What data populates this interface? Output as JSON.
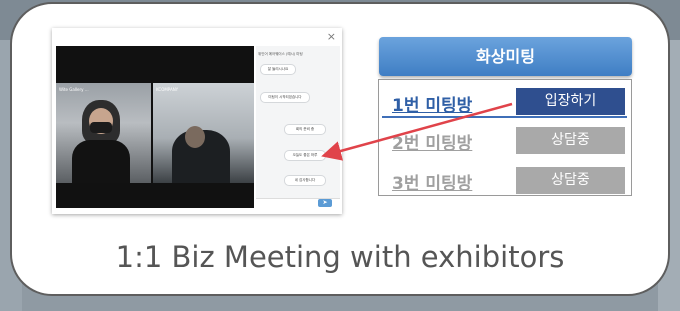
{
  "meeting_panel": {
    "title": "화상미팅",
    "rooms": [
      {
        "name": "1번 미팅방",
        "status": "입장하기"
      },
      {
        "name": "2번 미팅방",
        "status": "상담중"
      },
      {
        "name": "3번 미팅방",
        "status": "상담중"
      }
    ]
  },
  "screenshot": {
    "close": "×",
    "feed_labels": [
      "Wite Gallery ...",
      "KCOMPANY"
    ],
    "chat_title": "위인어 에어웨이스 (예시) 미팅",
    "bubbles": [
      "잘 들리시나요",
      "미팅이 시작되었습니다",
      "회의 준비 중",
      "오늘도 좋은 하루",
      "네 감사합니다"
    ],
    "send": "➤"
  },
  "caption": "1:1 Biz Meeting with exhibitors",
  "colors": {
    "accent": "#3f7ec4",
    "enter_button": "#2f4f8f",
    "busy_button": "#a9a9a9",
    "arrow": "#e0434a"
  }
}
